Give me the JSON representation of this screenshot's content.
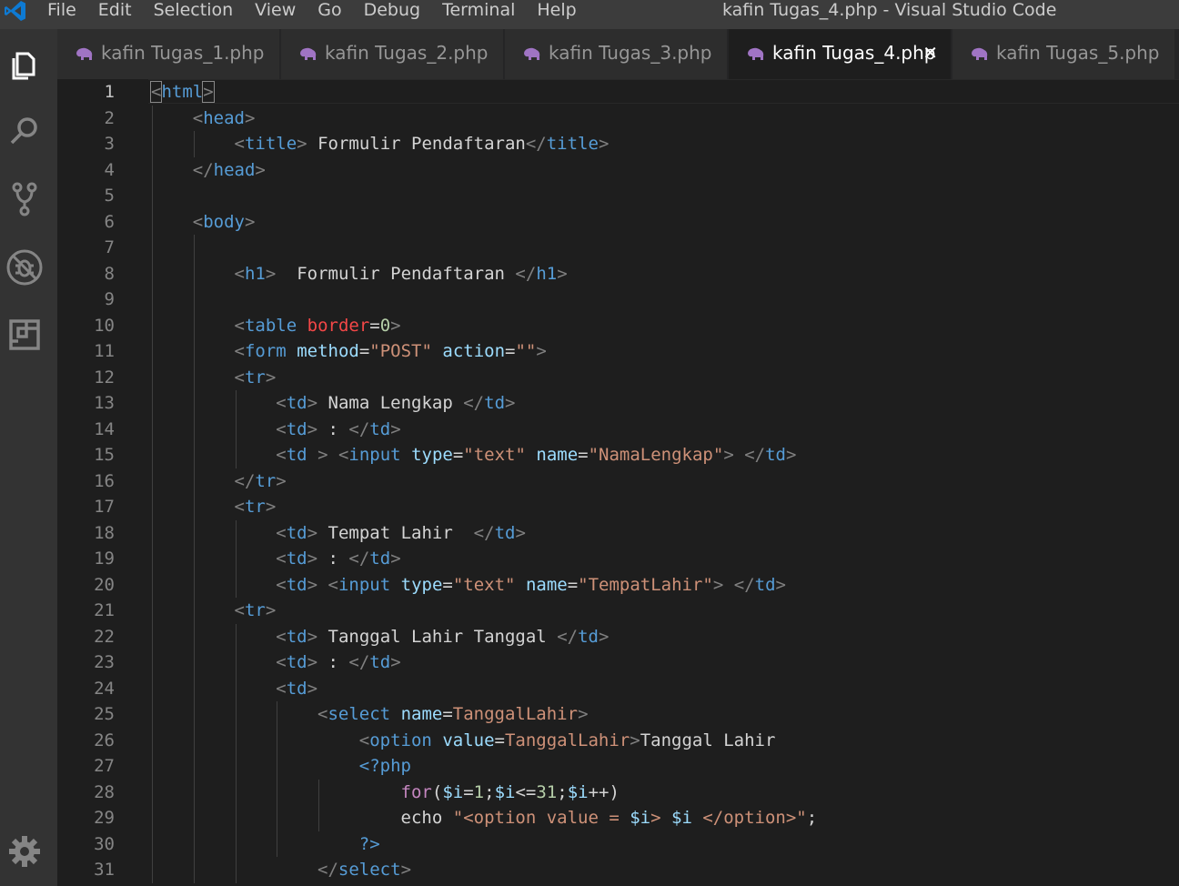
{
  "menu": [
    "File",
    "Edit",
    "Selection",
    "View",
    "Go",
    "Debug",
    "Terminal",
    "Help"
  ],
  "window_title": "kafin Tugas_4.php - Visual Studio Code",
  "activity_icons": [
    "files-icon",
    "search-icon",
    "source-control-icon",
    "debug-icon",
    "extensions-icon",
    "settings-gear-icon"
  ],
  "tabs": [
    {
      "label": "kafin Tugas_1.php",
      "active": false
    },
    {
      "label": "kafin Tugas_2.php",
      "active": false
    },
    {
      "label": "kafin Tugas_3.php",
      "active": false
    },
    {
      "label": "kafin Tugas_4.php",
      "active": true
    },
    {
      "label": "kafin Tugas_5.php",
      "active": false
    }
  ],
  "tab_close_glyph": "✕",
  "colors": {
    "tag": "#569cd6",
    "attribute": "#9cdcfe",
    "string": "#ce9178",
    "text": "#d4d4d4",
    "punctuation": "#808080",
    "attr_invalid": "#f44747",
    "number": "#b5cea8",
    "keyword": "#c586c0",
    "php_variable": "#9cdcfe",
    "editor_bg": "#1e1e1e",
    "activitybar_bg": "#333333",
    "titlebar_bg": "#3c3c3c"
  },
  "code": [
    {
      "n": "1",
      "indent": 0,
      "current": true,
      "tokens": [
        [
          "p",
          "<"
        ],
        [
          "t",
          "html"
        ],
        [
          "p",
          ">"
        ]
      ]
    },
    {
      "n": "2",
      "indent": 1,
      "tokens": [
        [
          "p",
          "<"
        ],
        [
          "t",
          "head"
        ],
        [
          "p",
          ">"
        ]
      ]
    },
    {
      "n": "3",
      "indent": 2,
      "tokens": [
        [
          "p",
          "<"
        ],
        [
          "t",
          "title"
        ],
        [
          "p",
          "> "
        ],
        [
          "x",
          "Formulir Pendaftaran"
        ],
        [
          "p",
          "</"
        ],
        [
          "t",
          "title"
        ],
        [
          "p",
          ">"
        ]
      ]
    },
    {
      "n": "4",
      "indent": 1,
      "tokens": [
        [
          "p",
          "</"
        ],
        [
          "t",
          "head"
        ],
        [
          "p",
          ">"
        ]
      ]
    },
    {
      "n": "5",
      "indent": 0,
      "tokens": []
    },
    {
      "n": "6",
      "indent": 1,
      "tokens": [
        [
          "p",
          "<"
        ],
        [
          "t",
          "body"
        ],
        [
          "p",
          ">"
        ]
      ]
    },
    {
      "n": "7",
      "indent": 0,
      "tokens": []
    },
    {
      "n": "8",
      "indent": 2,
      "tokens": [
        [
          "p",
          "<"
        ],
        [
          "t",
          "h1"
        ],
        [
          "p",
          ">"
        ],
        [
          "x",
          "  Formulir Pendaftaran "
        ],
        [
          "p",
          "</"
        ],
        [
          "t",
          "h1"
        ],
        [
          "p",
          ">"
        ]
      ]
    },
    {
      "n": "9",
      "indent": 0,
      "tokens": []
    },
    {
      "n": "10",
      "indent": 2,
      "tokens": [
        [
          "p",
          "<"
        ],
        [
          "t",
          "table"
        ],
        [
          "x",
          " "
        ],
        [
          "r",
          "border"
        ],
        [
          "x",
          "="
        ],
        [
          "n",
          "0"
        ],
        [
          "p",
          ">"
        ]
      ]
    },
    {
      "n": "11",
      "indent": 2,
      "tokens": [
        [
          "p",
          "<"
        ],
        [
          "t",
          "form"
        ],
        [
          "x",
          " "
        ],
        [
          "a",
          "method"
        ],
        [
          "x",
          "="
        ],
        [
          "s",
          "\"POST\""
        ],
        [
          "x",
          " "
        ],
        [
          "a",
          "action"
        ],
        [
          "x",
          "="
        ],
        [
          "s",
          "\"\""
        ],
        [
          "p",
          ">"
        ]
      ]
    },
    {
      "n": "12",
      "indent": 2,
      "tokens": [
        [
          "p",
          "<"
        ],
        [
          "t",
          "tr"
        ],
        [
          "p",
          ">"
        ]
      ]
    },
    {
      "n": "13",
      "indent": 3,
      "tokens": [
        [
          "p",
          "<"
        ],
        [
          "t",
          "td"
        ],
        [
          "p",
          "> "
        ],
        [
          "x",
          "Nama Lengkap "
        ],
        [
          "p",
          "</"
        ],
        [
          "t",
          "td"
        ],
        [
          "p",
          ">"
        ]
      ]
    },
    {
      "n": "14",
      "indent": 3,
      "tokens": [
        [
          "p",
          "<"
        ],
        [
          "t",
          "td"
        ],
        [
          "p",
          "> "
        ],
        [
          "x",
          ": "
        ],
        [
          "p",
          "</"
        ],
        [
          "t",
          "td"
        ],
        [
          "p",
          ">"
        ]
      ]
    },
    {
      "n": "15",
      "indent": 3,
      "tokens": [
        [
          "p",
          "<"
        ],
        [
          "t",
          "td"
        ],
        [
          "p",
          " > "
        ],
        [
          "p",
          "<"
        ],
        [
          "t",
          "input"
        ],
        [
          "x",
          " "
        ],
        [
          "a",
          "type"
        ],
        [
          "x",
          "="
        ],
        [
          "s",
          "\"text\""
        ],
        [
          "x",
          " "
        ],
        [
          "a",
          "name"
        ],
        [
          "x",
          "="
        ],
        [
          "s",
          "\"NamaLengkap\""
        ],
        [
          "p",
          "> "
        ],
        [
          "p",
          "</"
        ],
        [
          "t",
          "td"
        ],
        [
          "p",
          ">"
        ]
      ]
    },
    {
      "n": "16",
      "indent": 2,
      "tokens": [
        [
          "p",
          "</"
        ],
        [
          "t",
          "tr"
        ],
        [
          "p",
          ">"
        ]
      ]
    },
    {
      "n": "17",
      "indent": 2,
      "tokens": [
        [
          "p",
          "<"
        ],
        [
          "t",
          "tr"
        ],
        [
          "p",
          ">"
        ]
      ]
    },
    {
      "n": "18",
      "indent": 3,
      "tokens": [
        [
          "p",
          "<"
        ],
        [
          "t",
          "td"
        ],
        [
          "p",
          "> "
        ],
        [
          "x",
          "Tempat Lahir  "
        ],
        [
          "p",
          "</"
        ],
        [
          "t",
          "td"
        ],
        [
          "p",
          ">"
        ]
      ]
    },
    {
      "n": "19",
      "indent": 3,
      "tokens": [
        [
          "p",
          "<"
        ],
        [
          "t",
          "td"
        ],
        [
          "p",
          "> "
        ],
        [
          "x",
          ": "
        ],
        [
          "p",
          "</"
        ],
        [
          "t",
          "td"
        ],
        [
          "p",
          ">"
        ]
      ]
    },
    {
      "n": "20",
      "indent": 3,
      "tokens": [
        [
          "p",
          "<"
        ],
        [
          "t",
          "td"
        ],
        [
          "p",
          "> "
        ],
        [
          "p",
          "<"
        ],
        [
          "t",
          "input"
        ],
        [
          "x",
          " "
        ],
        [
          "a",
          "type"
        ],
        [
          "x",
          "="
        ],
        [
          "s",
          "\"text\""
        ],
        [
          "x",
          " "
        ],
        [
          "a",
          "name"
        ],
        [
          "x",
          "="
        ],
        [
          "s",
          "\"TempatLahir\""
        ],
        [
          "p",
          "> "
        ],
        [
          "p",
          "</"
        ],
        [
          "t",
          "td"
        ],
        [
          "p",
          ">"
        ]
      ]
    },
    {
      "n": "21",
      "indent": 2,
      "tokens": [
        [
          "p",
          "<"
        ],
        [
          "t",
          "tr"
        ],
        [
          "p",
          ">"
        ]
      ]
    },
    {
      "n": "22",
      "indent": 3,
      "tokens": [
        [
          "p",
          "<"
        ],
        [
          "t",
          "td"
        ],
        [
          "p",
          "> "
        ],
        [
          "x",
          "Tanggal Lahir Tanggal "
        ],
        [
          "p",
          "</"
        ],
        [
          "t",
          "td"
        ],
        [
          "p",
          ">"
        ]
      ]
    },
    {
      "n": "23",
      "indent": 3,
      "tokens": [
        [
          "p",
          "<"
        ],
        [
          "t",
          "td"
        ],
        [
          "p",
          "> "
        ],
        [
          "x",
          ": "
        ],
        [
          "p",
          "</"
        ],
        [
          "t",
          "td"
        ],
        [
          "p",
          ">"
        ]
      ]
    },
    {
      "n": "24",
      "indent": 3,
      "tokens": [
        [
          "p",
          "<"
        ],
        [
          "t",
          "td"
        ],
        [
          "p",
          ">"
        ]
      ]
    },
    {
      "n": "25",
      "indent": 4,
      "tokens": [
        [
          "p",
          "<"
        ],
        [
          "t",
          "select"
        ],
        [
          "x",
          " "
        ],
        [
          "a",
          "name"
        ],
        [
          "x",
          "="
        ],
        [
          "s",
          "TanggalLahir"
        ],
        [
          "p",
          ">"
        ]
      ]
    },
    {
      "n": "26",
      "indent": 5,
      "tokens": [
        [
          "p",
          "<"
        ],
        [
          "t",
          "option"
        ],
        [
          "x",
          " "
        ],
        [
          "a",
          "value"
        ],
        [
          "x",
          "="
        ],
        [
          "s",
          "TanggalLahir"
        ],
        [
          "p",
          ">"
        ],
        [
          "x",
          "Tanggal Lahir"
        ]
      ]
    },
    {
      "n": "27",
      "indent": 5,
      "tokens": [
        [
          "h",
          "<?php"
        ]
      ]
    },
    {
      "n": "28",
      "indent": 6,
      "tokens": [
        [
          "k",
          "for"
        ],
        [
          "x",
          "("
        ],
        [
          "v",
          "$i"
        ],
        [
          "x",
          "="
        ],
        [
          "n",
          "1"
        ],
        [
          "x",
          ";"
        ],
        [
          "v",
          "$i"
        ],
        [
          "x",
          "<="
        ],
        [
          "n",
          "31"
        ],
        [
          "x",
          ";"
        ],
        [
          "v",
          "$i"
        ],
        [
          "x",
          "++)"
        ]
      ]
    },
    {
      "n": "29",
      "indent": 6,
      "tokens": [
        [
          "x",
          "echo "
        ],
        [
          "s",
          "\"<option value = "
        ],
        [
          "v",
          "$i"
        ],
        [
          "s",
          "> "
        ],
        [
          "v",
          "$i"
        ],
        [
          "s",
          " </option>\""
        ],
        [
          "x",
          ";"
        ]
      ]
    },
    {
      "n": "30",
      "indent": 5,
      "tokens": [
        [
          "h",
          "?>"
        ]
      ]
    },
    {
      "n": "31",
      "indent": 4,
      "tokens": [
        [
          "p",
          "</"
        ],
        [
          "t",
          "select"
        ],
        [
          "p",
          ">"
        ]
      ]
    }
  ]
}
